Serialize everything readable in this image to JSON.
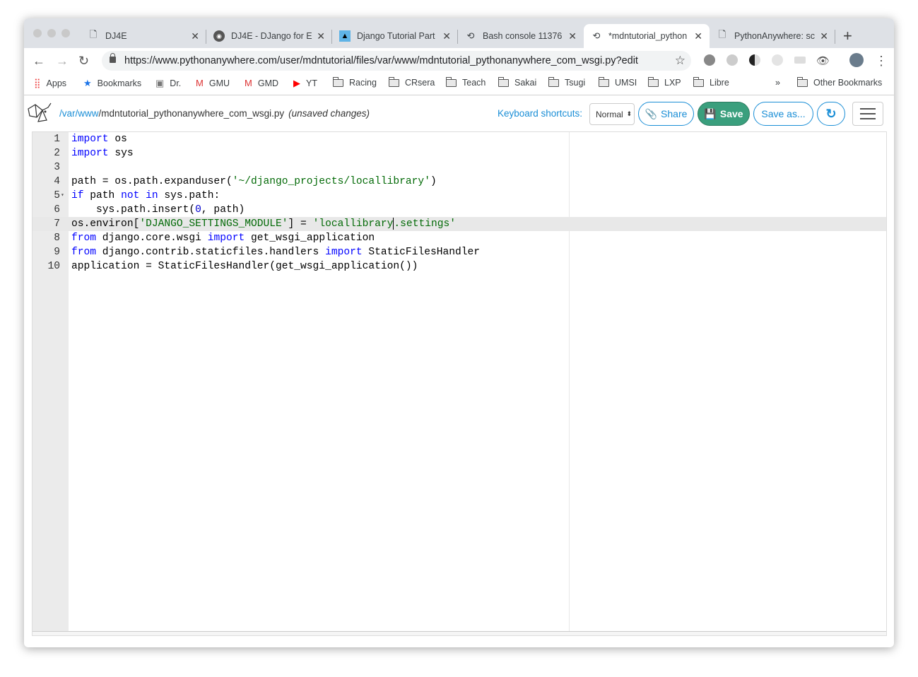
{
  "browser": {
    "tabs": [
      {
        "title": "DJ4E",
        "icon": "page-icon"
      },
      {
        "title": "DJ4E - DJango for E",
        "icon": "dj4e-logo-icon"
      },
      {
        "title": "Django Tutorial Part",
        "icon": "mdn-icon"
      },
      {
        "title": "Bash console 11376",
        "icon": "pythonanywhere-icon"
      },
      {
        "title": "*mdntutorial_python",
        "icon": "pythonanywhere-icon"
      },
      {
        "title": "PythonAnywhere: sc",
        "icon": "page-icon"
      }
    ],
    "url": "https://www.pythonanywhere.com/user/mdntutorial/files/var/www/mdntutorial_pythonanywhere_com_wsgi.py?edit",
    "bookmarks": [
      "Apps",
      "Bookmarks",
      "Dr.",
      "GMU",
      "GMD",
      "YT",
      "Racing",
      "CRsera",
      "Teach",
      "Sakai",
      "Tsugi",
      "UMSI",
      "LXP",
      "Libre"
    ],
    "overflow": "»",
    "other_bookmarks": "Other Bookmarks"
  },
  "editor": {
    "path_parts": [
      "/var",
      "/www",
      "/mdntutorial_pythonanywhere_com_wsgi.py"
    ],
    "status": "(unsaved changes)",
    "keyboard_label": "Keyboard shortcuts:",
    "keyboard_mode": "Normal",
    "share": "Share",
    "save": "Save",
    "save_as": "Save as...",
    "colors": {
      "accent": "#1a8ed6",
      "save": "#3a9f7d"
    },
    "lines": [
      [
        [
          "kw",
          "import"
        ],
        [
          "",
          "os"
        ]
      ],
      [
        [
          "kw",
          "import"
        ],
        [
          "",
          "sys"
        ]
      ],
      [],
      [
        [
          "",
          "path = os.path.expanduser("
        ],
        [
          "str",
          "'~/django_projects/locallibrary'"
        ],
        [
          "",
          ")"
        ]
      ],
      [
        [
          "kw",
          "if"
        ],
        [
          "",
          "path "
        ],
        [
          "kw",
          "not"
        ],
        [
          "kw",
          "in"
        ],
        [
          "",
          "sys.path:"
        ]
      ],
      [
        [
          "",
          "    sys.path.insert("
        ],
        [
          "num",
          "0"
        ],
        [
          "",
          ", path)"
        ]
      ],
      [
        [
          "",
          "os.environ["
        ],
        [
          "str",
          "'DJANGO_SETTINGS_MODULE'"
        ],
        [
          "",
          "] = "
        ],
        [
          "str",
          "'locallibrary"
        ],
        [
          "cursor",
          ""
        ],
        [
          "str",
          ".settings'"
        ]
      ],
      [
        [
          "kw",
          "from"
        ],
        [
          "",
          "django.core.wsgi "
        ],
        [
          "kw",
          "import"
        ],
        [
          "",
          "get_wsgi_application"
        ]
      ],
      [
        [
          "kw",
          "from"
        ],
        [
          "",
          "django.contrib.staticfiles.handlers "
        ],
        [
          "kw",
          "import"
        ],
        [
          "",
          "StaticFilesHandler"
        ]
      ],
      [
        [
          "",
          "application = StaticFilesHandler(get_wsgi_application())"
        ]
      ]
    ],
    "active_line": 7,
    "fold_lines": [
      5
    ]
  }
}
